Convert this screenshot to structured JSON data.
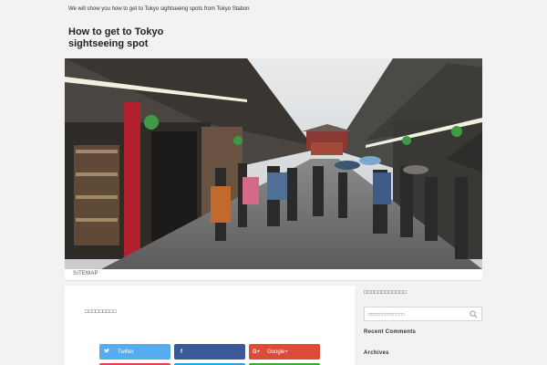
{
  "header": {
    "description": "We will show you how to get to Tokyo sightseeing spots from Tokyo Station",
    "title": "How to get to Tokyo sightseeing spot"
  },
  "nav": {
    "sitemap_label": "SITEMAP"
  },
  "post": {
    "title": "□□□□□□□□□",
    "share_buttons": [
      {
        "label": "Twitter",
        "icon": "twitter-icon"
      },
      {
        "label": "",
        "icon": "facebook-icon"
      },
      {
        "label": "Google+",
        "icon": "google-plus-icon"
      }
    ]
  },
  "sidebar": {
    "search_widget_title": "□□□□□□□□□□□□",
    "search_placeholder": "□□□□□□□□□□□□□",
    "recent_comments_title": "Recent Comments",
    "archives_title": "Archives"
  },
  "colors": {
    "twitter": "#55acee",
    "facebook": "#3b5998",
    "google_plus": "#dd4b39"
  }
}
